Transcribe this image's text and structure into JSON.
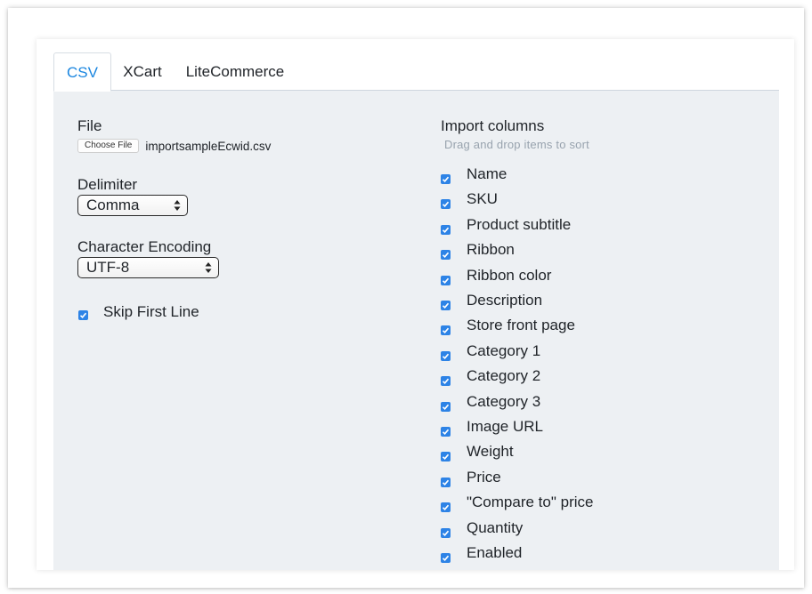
{
  "tabs": [
    {
      "label": "CSV",
      "active": true
    },
    {
      "label": "XCart",
      "active": false
    },
    {
      "label": "LiteCommerce",
      "active": false
    }
  ],
  "colors": {
    "accent": "#1a86e0",
    "checkbox": "#2d83e6",
    "panel_bg": "#edf0f3",
    "hint_text": "#98a3ae"
  },
  "form": {
    "file": {
      "label": "File",
      "button_label": "Choose File",
      "file_name": "importsampleEcwid.csv"
    },
    "delimiter": {
      "label": "Delimiter",
      "value": "Comma"
    },
    "encoding": {
      "label": "Character Encoding",
      "value": "UTF-8"
    },
    "skip_first_line": {
      "label": "Skip First Line",
      "checked": true
    }
  },
  "import_columns": {
    "title": "Import columns",
    "hint": "Drag and drop items to sort",
    "items": [
      {
        "label": "Name",
        "checked": true
      },
      {
        "label": "SKU",
        "checked": true
      },
      {
        "label": "Product subtitle",
        "checked": true
      },
      {
        "label": "Ribbon",
        "checked": true
      },
      {
        "label": "Ribbon color",
        "checked": true
      },
      {
        "label": "Description",
        "checked": true
      },
      {
        "label": "Store front page",
        "checked": true
      },
      {
        "label": "Category 1",
        "checked": true
      },
      {
        "label": "Category 2",
        "checked": true
      },
      {
        "label": "Category 3",
        "checked": true
      },
      {
        "label": "Image URL",
        "checked": true
      },
      {
        "label": "Weight",
        "checked": true
      },
      {
        "label": "Price",
        "checked": true
      },
      {
        "label": "\"Compare to\" price",
        "checked": true
      },
      {
        "label": "Quantity",
        "checked": true
      },
      {
        "label": "Enabled",
        "checked": true
      }
    ]
  }
}
